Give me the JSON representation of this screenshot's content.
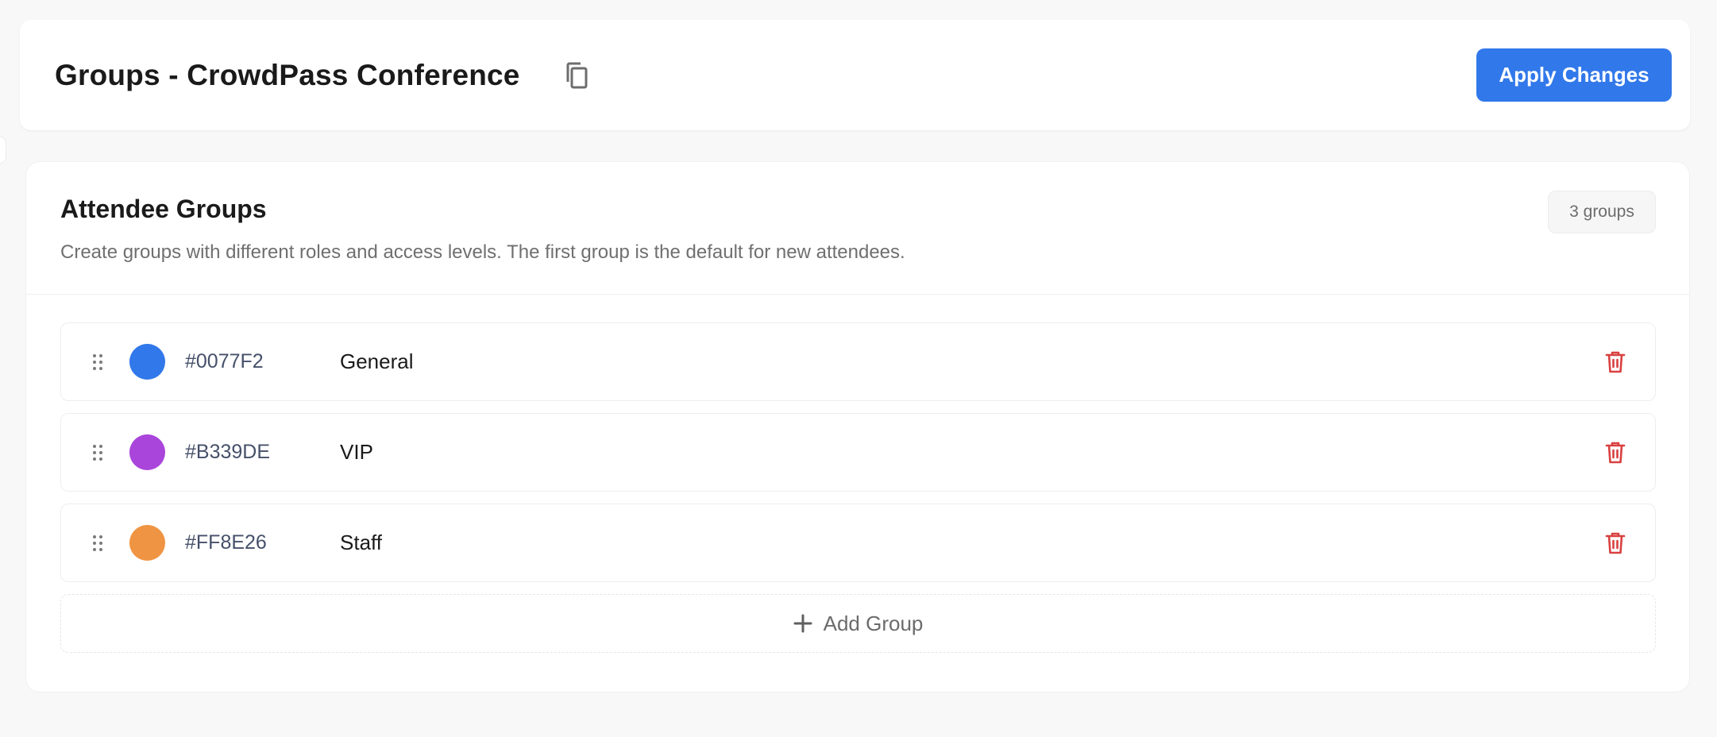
{
  "header": {
    "title": "Groups - CrowdPass Conference",
    "copy_icon": "copy-icon",
    "apply_label": "Apply Changes"
  },
  "section": {
    "title": "Attendee Groups",
    "description": "Create groups with different roles and access levels. The first group is the default for new attendees.",
    "count_label": "3 groups"
  },
  "groups": [
    {
      "hex": "#0077F2",
      "name": "General",
      "swatch_color": "#3178ea"
    },
    {
      "hex": "#B339DE",
      "name": "VIP",
      "swatch_color": "#aa45db"
    },
    {
      "hex": "#FF8E26",
      "name": "Staff",
      "swatch_color": "#ef9443"
    }
  ],
  "add_group_label": "Add Group",
  "colors": {
    "accent": "#3178ea",
    "delete": "#d94040",
    "background": "#f8f8f8"
  },
  "icons": {
    "drag": "drag-handle-icon",
    "delete": "trash-icon",
    "add": "plus-icon"
  }
}
